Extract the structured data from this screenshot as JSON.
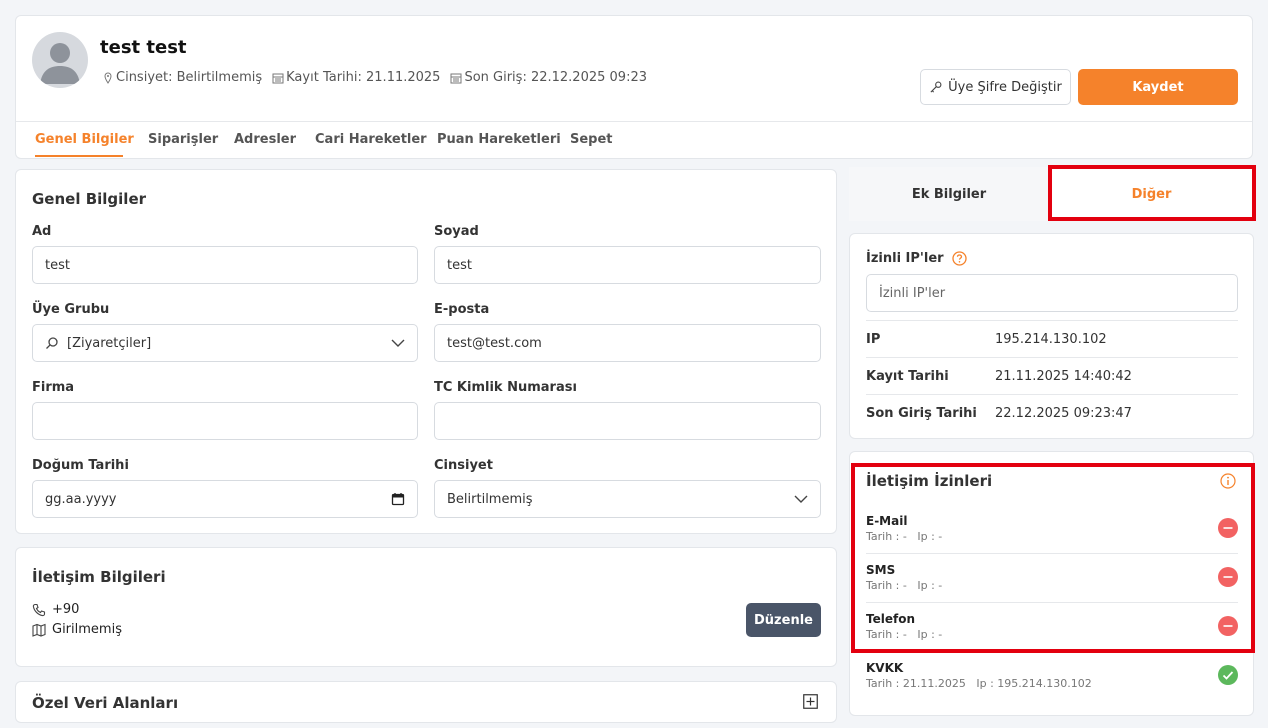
{
  "user": {
    "name": "test test",
    "gender_meta": "Cinsiyet: Belirtilmemiş",
    "register_meta": "Kayıt Tarihi: 21.11.2025",
    "last_login_meta": "Son Giriş: 22.12.2025 09:23"
  },
  "actions": {
    "change_password": "Üye Şifre Değiştir",
    "save": "Kaydet"
  },
  "tabs": [
    {
      "label": "Genel Bilgiler",
      "active": true
    },
    {
      "label": "Siparişler"
    },
    {
      "label": "Adresler"
    },
    {
      "label": "Cari Hareketler"
    },
    {
      "label": "Puan Hareketleri"
    },
    {
      "label": "Sepet"
    }
  ],
  "general": {
    "title": "Genel Bilgiler",
    "ad_label": "Ad",
    "ad_value": "test",
    "soyad_label": "Soyad",
    "soyad_value": "test",
    "group_label": "Üye Grubu",
    "group_value": "[Ziyaretçiler]",
    "email_label": "E-posta",
    "email_value": "test@test.com",
    "company_label": "Firma",
    "company_value": "",
    "tc_label": "TC Kimlik Numarası",
    "tc_value": "",
    "birth_label": "Doğum Tarihi",
    "birth_placeholder": "gg.aa.yyyy",
    "gender_label": "Cinsiyet",
    "gender_value": "Belirtilmemiş"
  },
  "contact": {
    "title": "İletişim Bilgileri",
    "phone": "+90",
    "address": "Girilmemiş",
    "edit": "Düzenle"
  },
  "special": {
    "title": "Özel Veri Alanları"
  },
  "right_tabs": {
    "extra": "Ek Bilgiler",
    "other": "Diğer"
  },
  "ip": {
    "label": "İzinli IP'ler",
    "placeholder": "İzinli IP'ler",
    "rows": [
      {
        "k": "IP",
        "v": "195.214.130.102"
      },
      {
        "k": "Kayıt Tarihi",
        "v": "21.11.2025 14:40:42"
      },
      {
        "k": "Son Giriş Tarihi",
        "v": "22.12.2025 09:23:47"
      }
    ]
  },
  "permissions": {
    "title": "İletişim İzinleri",
    "items": [
      {
        "name": "E-Mail",
        "detail": "Tarih : -   Ip : -",
        "status": "off"
      },
      {
        "name": "SMS",
        "detail": "Tarih : -   Ip : -",
        "status": "off"
      },
      {
        "name": "Telefon",
        "detail": "Tarih : -   Ip : -",
        "status": "off"
      },
      {
        "name": "KVKK",
        "detail": "Tarih : 21.11.2025   Ip : 195.214.130.102",
        "status": "on"
      }
    ]
  },
  "colors": {
    "accent": "#f5822b",
    "highlight": "#e3000f",
    "status_off": "#f26262",
    "status_on": "#5cb85c"
  }
}
